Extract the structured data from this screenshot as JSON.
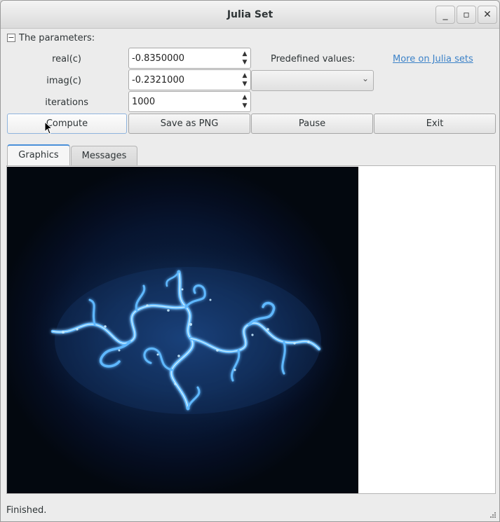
{
  "window": {
    "title": "Julia Set",
    "minimize_glyph": "_",
    "maximize_glyph": "▫",
    "close_glyph": "✕"
  },
  "params": {
    "collapse_glyph": "−",
    "header": "The parameters:",
    "real_label": "real(c)",
    "real_value": "-0.8350000",
    "imag_label": "imag(c)",
    "imag_value": "-0.2321000",
    "iter_label": "iterations",
    "iter_value": "1000",
    "predefined_label": "Predefined values:",
    "predefined_selected": "",
    "more_link": "More on Julia sets"
  },
  "buttons": {
    "compute": "Compute",
    "save": "Save as PNG",
    "pause": "Pause",
    "exit": "Exit"
  },
  "tabs": [
    {
      "label": "Graphics",
      "active": true
    },
    {
      "label": "Messages",
      "active": false
    }
  ],
  "status": {
    "text": "Finished."
  },
  "colors": {
    "fractal_glow": "#5fb8ff",
    "fractal_core": "#c8ecff",
    "background": "#03080f",
    "link": "#3c82c8",
    "tab_accent": "#4a90d9"
  }
}
